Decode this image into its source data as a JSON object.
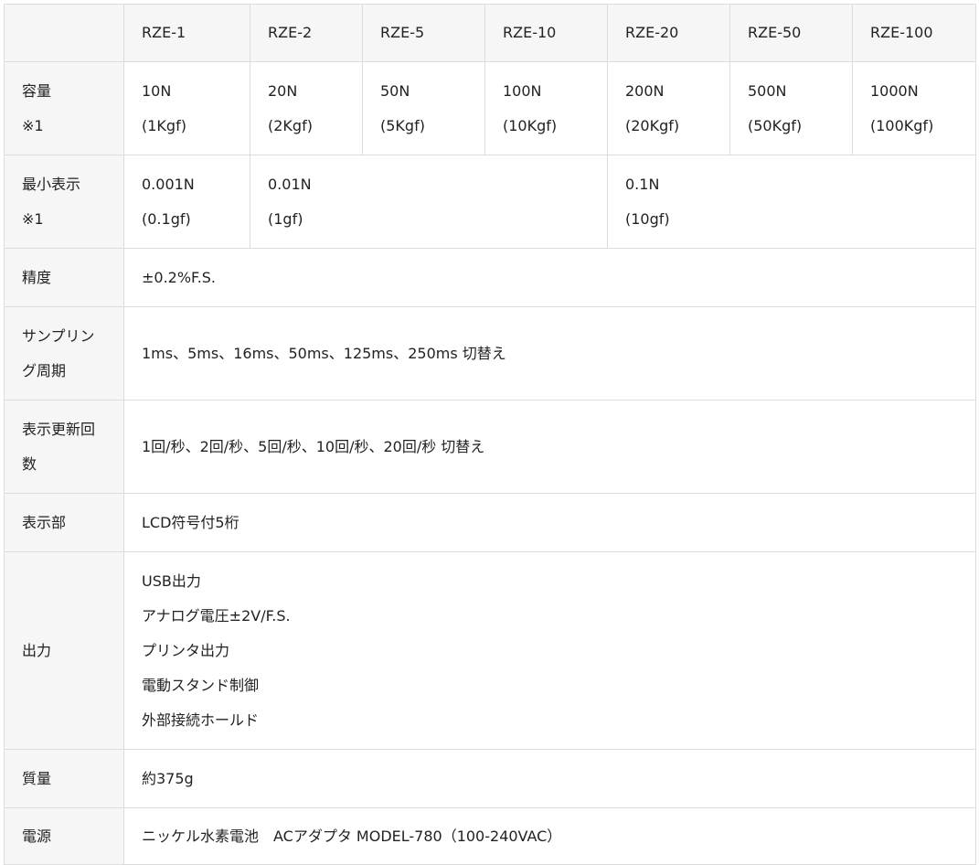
{
  "header": {
    "models": [
      "RZE-1",
      "RZE-2",
      "RZE-5",
      "RZE-10",
      "RZE-20",
      "RZE-50",
      "RZE-100"
    ]
  },
  "capacity": {
    "label": "容量",
    "note": "※1",
    "values": [
      {
        "n": "10N",
        "kgf": "(1Kgf)"
      },
      {
        "n": "20N",
        "kgf": "(2Kgf)"
      },
      {
        "n": "50N",
        "kgf": "(5Kgf)"
      },
      {
        "n": "100N",
        "kgf": "(10Kgf)"
      },
      {
        "n": "200N",
        "kgf": "(20Kgf)"
      },
      {
        "n": "500N",
        "kgf": "(50Kgf)"
      },
      {
        "n": "1000N",
        "kgf": "(100Kgf)"
      }
    ]
  },
  "min_display": {
    "label": "最小表示",
    "note": "※1",
    "values": [
      {
        "n": "0.001N",
        "gf": "(0.1gf)"
      },
      {
        "n": "0.01N",
        "gf": "(1gf)"
      },
      {
        "n": "0.1N",
        "gf": "(10gf)"
      }
    ]
  },
  "accuracy": {
    "label": "精度",
    "value": "±0.2%F.S."
  },
  "sampling": {
    "label_1": "サンプリン",
    "label_2": "グ周期",
    "value": "1ms、5ms、16ms、50ms、125ms、250ms 切替え"
  },
  "refresh": {
    "label_1": "表示更新回",
    "label_2": "数",
    "value": "1回/秒、2回/秒、5回/秒、10回/秒、20回/秒 切替え"
  },
  "display": {
    "label": "表示部",
    "value": "LCD符号付5桁"
  },
  "output": {
    "label": "出力",
    "items": [
      "USB出力",
      "アナログ電圧±2V/F.S.",
      "プリンタ出力",
      "電動スタンド制御",
      "外部接続ホールド"
    ]
  },
  "mass": {
    "label": "質量",
    "value": "約375g"
  },
  "power": {
    "label": "電源",
    "value": "ニッケル水素電池　ACアダプタ MODEL-780（100-240VAC）"
  }
}
